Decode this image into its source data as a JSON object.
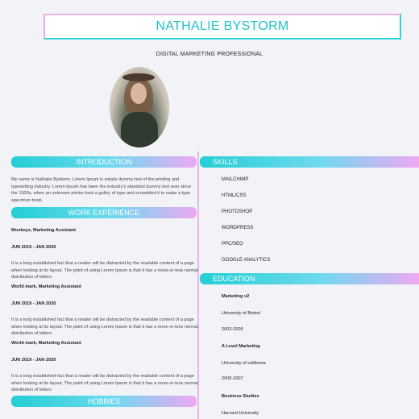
{
  "header": {
    "name": "NATHALIE BYSTORM",
    "title": "DIGITAL MARKETING PROFESSIONAL"
  },
  "sections": {
    "introduction": "INTRODUCTION",
    "work": "WORK EXPERIENCE",
    "hobbies": "HOBBIES",
    "skills": "SKILLS",
    "education": "EDUCATION"
  },
  "intro_text": "My name is Nathalie Bystorm. Lorem Ipsum is simply dummy text of the printing and typesetting industry. Lorem Ipsum has been the industry's standard dummy text ever since the 1500s, when an unknown printer took a galley of type and scrambled it to make a type specimen book.",
  "work": [
    {
      "role": "Monkeys, Marketing Assistant",
      "dates": "JUN 2019 - JAN 2020",
      "desc": "It is a long established fact that a reader will be distracted by the readable content of a page when looking at its layout. The point of using Lorem Ipsum is that it has a more-or-less normal distribution of letters"
    },
    {
      "role": "World mark, Marketing Assistant",
      "dates": "JUN 2019 - JAN 2020",
      "desc": "It is a long established fact that a reader will be distracted by the readable content of a page when looking at its layout. The point of using Lorem Ipsum is that it has a more-or-less normal distribution of letters"
    },
    {
      "role": "World mark, Marketing Assistant",
      "dates": "JUN 2019 - JAN 2020",
      "desc": "It is a long established fact that a reader will be distracted by the readable content of a page when looking at its layout. The point of using Lorem Ipsum is that it has a more-or-less normal distribution of letters"
    }
  ],
  "skills": [
    "MAILCHIMP",
    "HTML/CSS",
    "PHOTOSHOP",
    "WORDPRESS",
    "PPC/SEO",
    "GOOGLE ANALYTICS"
  ],
  "education": [
    {
      "degree": "Marketing v2",
      "school": "University of Bristol",
      "dates": "2002-2005"
    },
    {
      "degree": "A Level Marketing",
      "school": "University of california",
      "dates": "2005-2007"
    },
    {
      "degree": "Business Studies",
      "school": "Harvard University",
      "dates": ""
    }
  ]
}
